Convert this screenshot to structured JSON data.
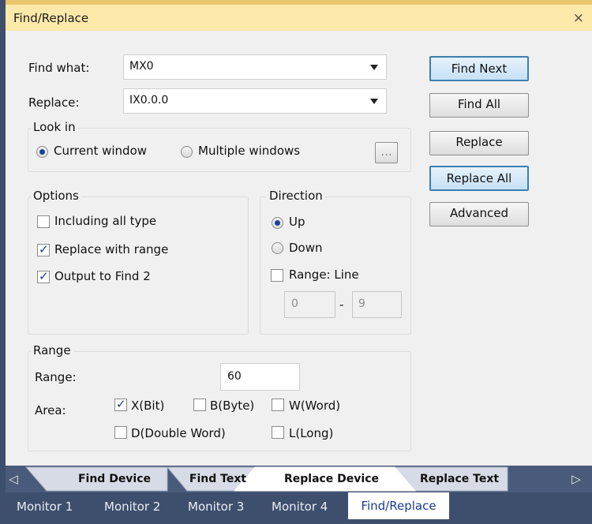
{
  "dialog": {
    "title": "Find/Replace",
    "close_label": "×"
  },
  "find": {
    "label": "Find what:",
    "value": "MX0"
  },
  "replace": {
    "label": "Replace:",
    "value": "IX0.0.0"
  },
  "look_in": {
    "title": "Look in",
    "options": [
      {
        "label": "Current window",
        "selected": true
      },
      {
        "label": "Multiple windows",
        "selected": false
      }
    ],
    "browse_label": "..."
  },
  "options": {
    "title": "Options",
    "items": [
      {
        "label": "Including all type",
        "checked": false
      },
      {
        "label": "Replace with range",
        "checked": true
      },
      {
        "label": "Output to Find 2",
        "checked": true
      }
    ]
  },
  "direction": {
    "title": "Direction",
    "options": [
      {
        "label": "Up",
        "selected": true
      },
      {
        "label": "Down",
        "selected": false
      }
    ],
    "range_line_label": "Range: Line",
    "range_line_checked": false,
    "line_from": "0",
    "line_sep": "-",
    "line_to": "9"
  },
  "range": {
    "title": "Range",
    "range_label": "Range:",
    "range_value": "60",
    "area_label": "Area:",
    "area_items": [
      {
        "label": "X(Bit)",
        "checked": true
      },
      {
        "label": "B(Byte)",
        "checked": false
      },
      {
        "label": "W(Word)",
        "checked": false
      },
      {
        "label": "D(Double Word)",
        "checked": false
      },
      {
        "label": "L(Long)",
        "checked": false
      }
    ]
  },
  "buttons": {
    "find_next": "Find Next",
    "find_all": "Find All",
    "replace": "Replace",
    "replace_all": "Replace All",
    "advanced": "Advanced"
  },
  "doc_tabs": {
    "left_arrow": "◁",
    "right_arrow": "▷",
    "items": [
      "Find Device",
      "Find Text",
      "Replace Device",
      "Replace Text"
    ],
    "active": "Replace Device"
  },
  "bottom_tabs": {
    "items": [
      "Monitor 1",
      "Monitor 2",
      "Monitor 3",
      "Monitor 4",
      "Find/Replace"
    ],
    "active": "Find/Replace"
  },
  "colors": {
    "title_bar": "#fde9a9",
    "default_button_border": "#3c7fb1",
    "frame": "#3e4f6e",
    "check_mark": "#1d3b8f"
  }
}
